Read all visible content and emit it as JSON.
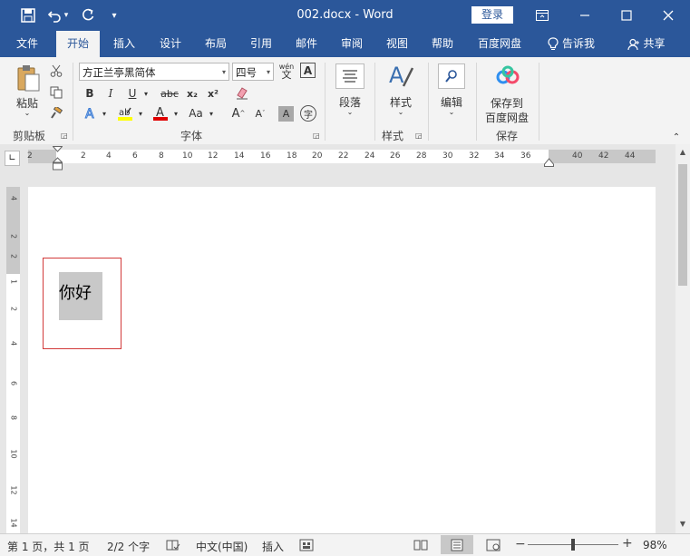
{
  "titlebar": {
    "title": "002.docx  -  Word",
    "login": "登录",
    "qat_customize": "₹"
  },
  "tabs": [
    "文件",
    "开始",
    "插入",
    "设计",
    "布局",
    "引用",
    "邮件",
    "审阅",
    "视图",
    "帮助",
    "百度网盘"
  ],
  "tell_me": "告诉我",
  "share": "共享",
  "ribbon": {
    "clipboard": {
      "paste": "粘贴",
      "group": "剪贴板"
    },
    "font": {
      "family": "方正兰亭黑简体",
      "size": "四号",
      "wen_top": "wén",
      "wen_bottom": "文",
      "bold": "B",
      "italic": "I",
      "underline": "U",
      "strike": "abc",
      "sub": "x₂",
      "sup": "x²",
      "aa": "Aa",
      "grow": "A",
      "shrink": "A",
      "char_shade": "A",
      "enclose": "字",
      "group": "字体"
    },
    "paragraph": {
      "label": "段落"
    },
    "styles": {
      "label": "样式",
      "group": "样式"
    },
    "editing": {
      "label": "编辑"
    },
    "save": {
      "label1": "保存到",
      "label2": "百度网盘",
      "group": "保存"
    }
  },
  "ruler": {
    "h_ticks": [
      "2",
      "2",
      "4",
      "6",
      "8",
      "10",
      "12",
      "14",
      "16",
      "18",
      "20",
      "22",
      "24",
      "26",
      "28",
      "30",
      "32",
      "34",
      "36",
      "40",
      "42",
      "44"
    ],
    "v_ticks": [
      "4",
      "2",
      "2",
      "1",
      "2",
      "4",
      "6",
      "8",
      "10",
      "12",
      "14"
    ]
  },
  "document": {
    "text": "你好"
  },
  "status": {
    "page": "第 1 页，共 1 页",
    "words": "2/2 个字",
    "language": "中文(中国)",
    "mode": "插入",
    "zoom": "98%"
  },
  "colors": {
    "brand": "#2b579a",
    "highlight": "#ffff00",
    "font_color": "#e00000",
    "textbox_border": "#d23a3a"
  }
}
